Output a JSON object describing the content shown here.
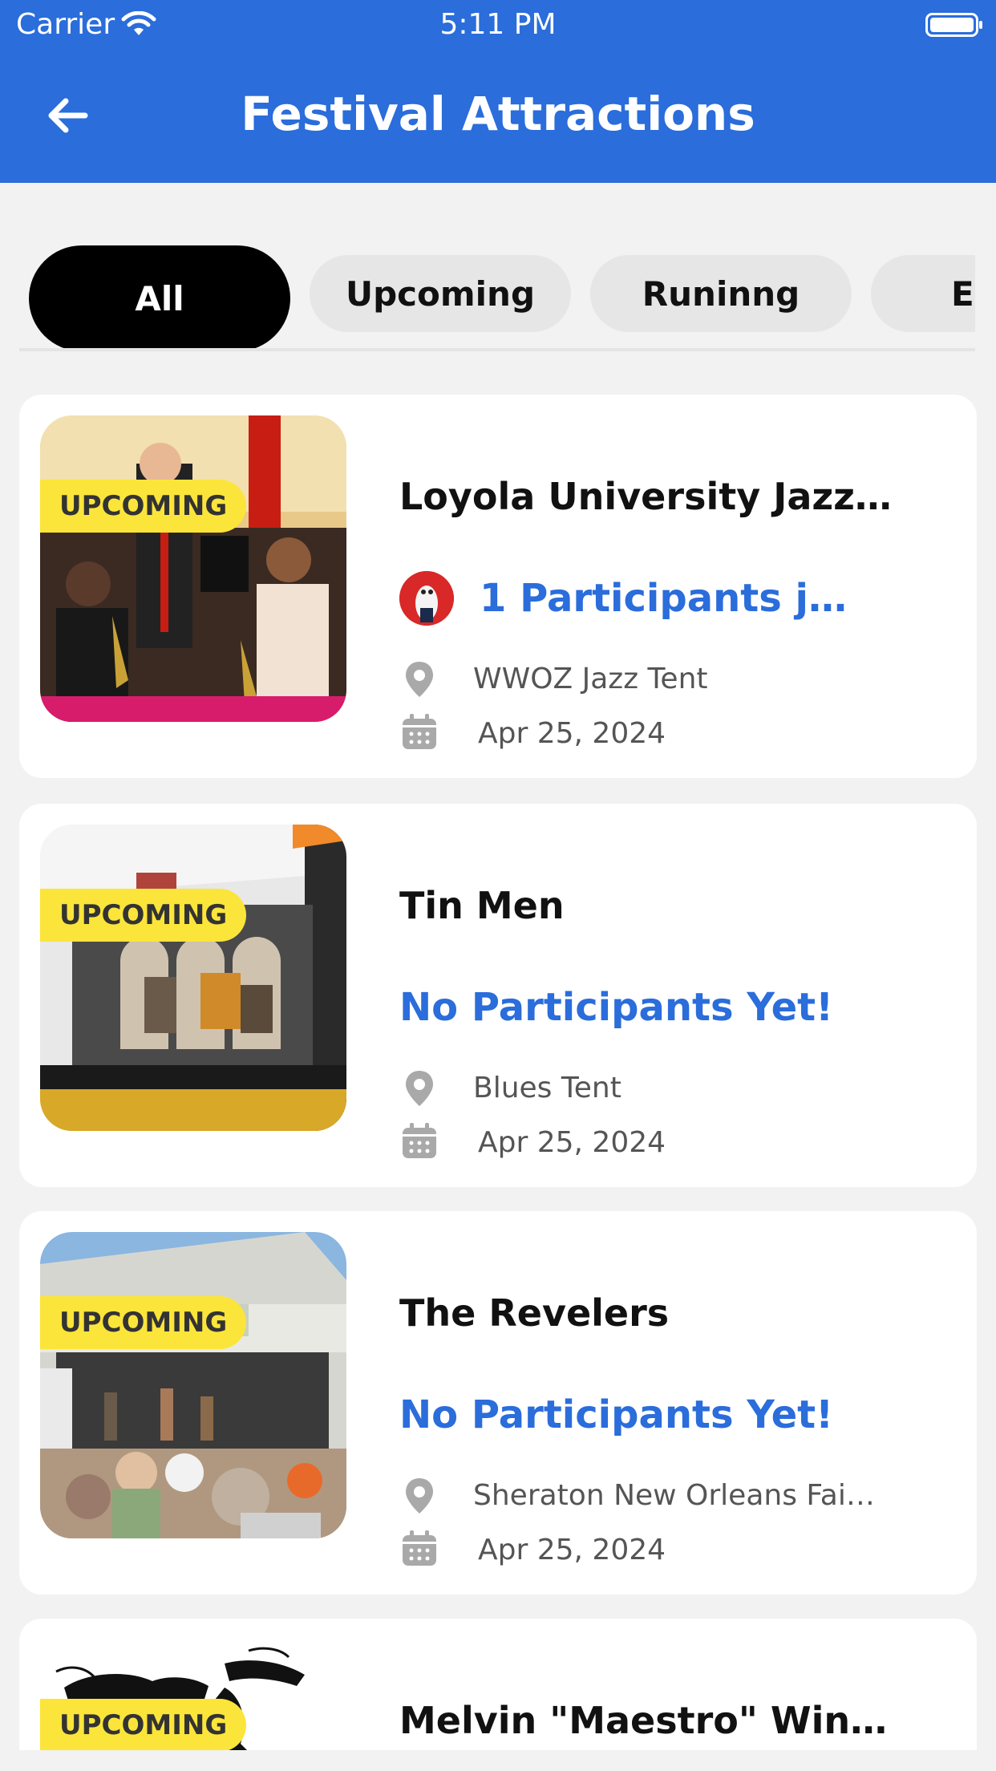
{
  "status_bar": {
    "carrier": "Carrier",
    "time": "5:11 PM"
  },
  "header": {
    "title": "Festival Attractions"
  },
  "tabs": [
    {
      "label": "All",
      "active": true
    },
    {
      "label": "Upcoming",
      "active": false
    },
    {
      "label": "Runinng",
      "active": false
    },
    {
      "label": "En",
      "active": false
    }
  ],
  "colors": {
    "header": "#2a6ddb",
    "accent": "#2a6ddb",
    "badge": "#fbe53a",
    "tab_active": "#000000"
  },
  "attractions": [
    {
      "status": "UPCOMING",
      "title": "Loyola University Jazz…",
      "participants": "1 Participants jo…",
      "location": "WWOZ Jazz Tent",
      "date": "Apr 25, 2024"
    },
    {
      "status": "UPCOMING",
      "title": "Tin Men",
      "participants": "No Participants Yet!",
      "location": "Blues Tent",
      "date": "Apr 25, 2024"
    },
    {
      "status": "UPCOMING",
      "title": "The Revelers",
      "participants": "No Participants Yet!",
      "location": "Sheraton New Orleans Fai…",
      "date": "Apr 25, 2024"
    },
    {
      "status": "UPCOMING",
      "title": "Melvin \"Maestro\" Win…"
    }
  ]
}
